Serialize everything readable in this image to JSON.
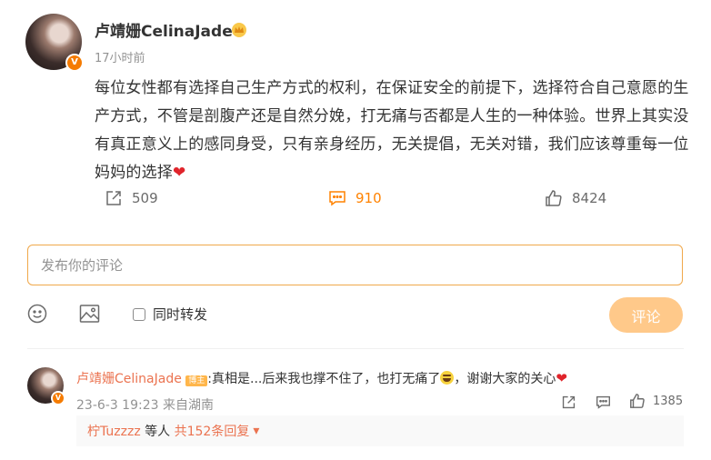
{
  "post": {
    "author": "卢靖姗CelinaJade",
    "time": "17小时前",
    "verified_badge": "V",
    "content": "每位女性都有选择自己生产方式的权利，在保证安全的前提下，选择符合自己意愿的生产方式，不管是剖腹产还是自然分娩，打无痛与否都是人生的一种体验。世界上其实没有真正意义上的感同身受，只有亲身经历，无关提倡，无关对错，我们应该尊重每一位妈妈的选择",
    "content_emoji": "❤",
    "actions": {
      "repost_count": "509",
      "comment_count": "910",
      "like_count": "8424"
    }
  },
  "composer": {
    "placeholder": "发布你的评论",
    "also_repost_label": "同时转发",
    "submit_label": "评论"
  },
  "comment": {
    "author": "卢靖姗CelinaJade",
    "role_badge": "博主",
    "verified_badge": "V",
    "text_part1": ":真相是...后来我也撑不住了，也打无痛了",
    "text_part2": "，谢谢大家的关心",
    "text_heart": "❤",
    "time": "23-6-3 19:23 来自湖南",
    "like_count": "1385",
    "reply_user": "柠Tuzzzz",
    "reply_mid": " 等人 ",
    "reply_total": "共152条回复",
    "reply_arrow": "▾"
  },
  "colors": {
    "accent": "#ff8200",
    "author_link": "#eb7350",
    "submit_bg": "#ffc98a",
    "heart": "#e0242b"
  },
  "icons": {
    "repost": "repost-icon",
    "comment": "comment-icon",
    "like": "thumbs-up-icon",
    "emoji": "smiley-icon",
    "image": "image-icon",
    "crown": "crown-icon"
  }
}
